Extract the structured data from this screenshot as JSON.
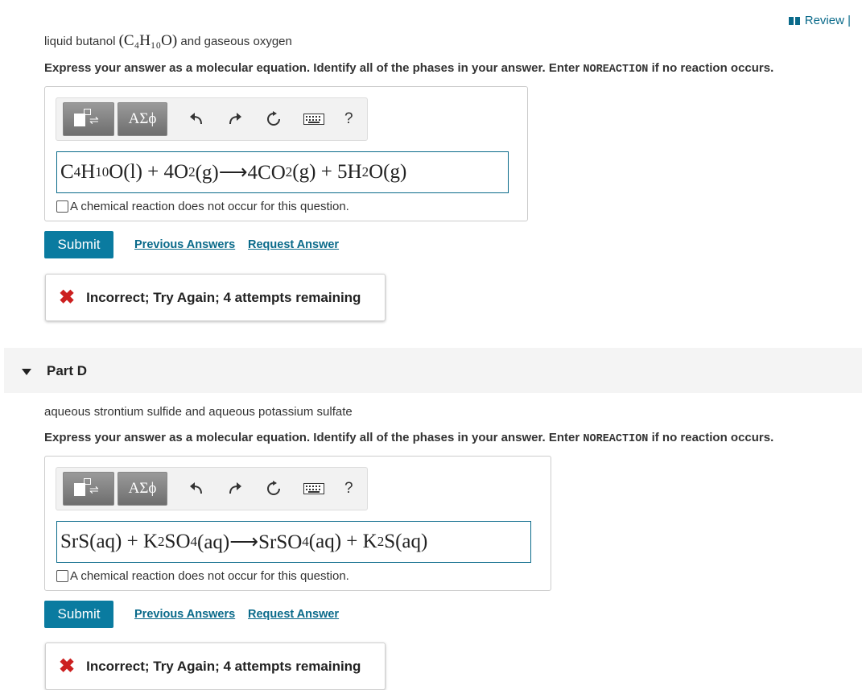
{
  "header": {
    "review_label": "Review |"
  },
  "part_c": {
    "prompt_pre": "liquid butanol ",
    "prompt_formula": "(C₄H₁₀O)",
    "prompt_post": " and gaseous oxygen",
    "instruction_pre": "Express your answer as a molecular equation. Identify all of the phases in your answer. Enter ",
    "instruction_code": "NOREACTION",
    "instruction_post": " if no reaction occurs.",
    "toolbar": {
      "symbols_label": "ΑΣϕ",
      "help_label": "?"
    },
    "equation": {
      "t1": "C",
      "s1": "4",
      "t2": "H",
      "s2": "10",
      "t3": "O(l) + 4O",
      "s3": "2",
      "t4": "(g)⟶4CO",
      "s4": "2",
      "t5": "(g) + 5H",
      "s5": "2",
      "t6": "O(g)"
    },
    "no_reaction_label": "A chemical reaction does not occur for this question.",
    "submit_label": "Submit",
    "previous_answers_label": "Previous Answers",
    "request_answer_label": "Request Answer",
    "feedback": "Incorrect; Try Again; 4 attempts remaining"
  },
  "part_d": {
    "title": "Part D",
    "prompt": "aqueous strontium sulfide and aqueous potassium sulfate",
    "instruction_pre": "Express your answer as a molecular equation. Identify all of the phases in your answer. Enter ",
    "instruction_code": "NOREACTION",
    "instruction_post": " if no reaction occurs.",
    "toolbar": {
      "symbols_label": "ΑΣϕ",
      "help_label": "?"
    },
    "equation": {
      "t1": "SrS(aq) + K",
      "s1": "2",
      "t2": "SO",
      "s2": "4",
      "t3": "(aq)⟶SrSO",
      "s3": "4",
      "t4": "(aq) + K",
      "s4": "2",
      "t5": "S(aq)"
    },
    "no_reaction_label": "A chemical reaction does not occur for this question.",
    "submit_label": "Submit",
    "previous_answers_label": "Previous Answers",
    "request_answer_label": "Request Answer",
    "feedback": "Incorrect; Try Again; 4 attempts remaining"
  },
  "colors": {
    "accent": "#0a7ba0",
    "link": "#0a6a8a",
    "error": "#cc1f1f"
  }
}
